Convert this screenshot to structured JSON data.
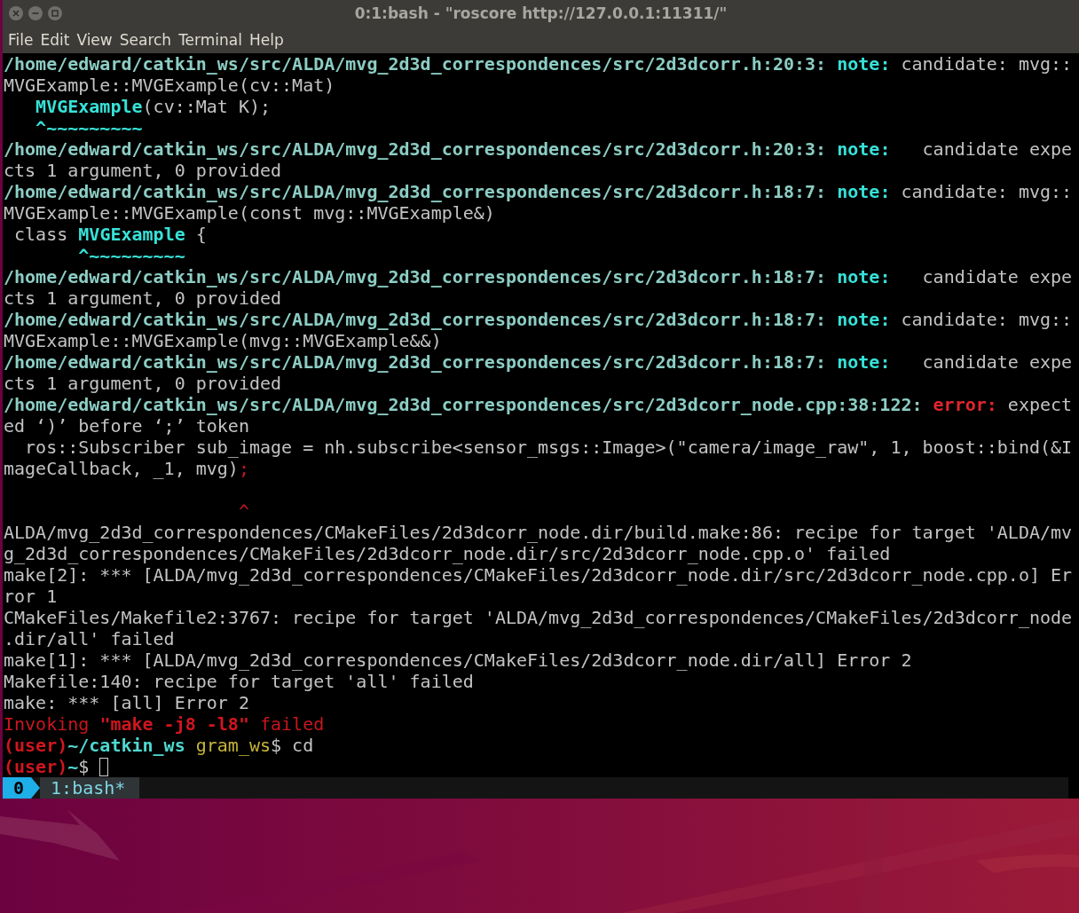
{
  "window": {
    "title": "0:1:bash - \"roscore http://127.0.0.1:11311/\""
  },
  "menu": [
    "File",
    "Edit",
    "View",
    "Search",
    "Terminal",
    "Help"
  ],
  "terminal": {
    "lines": [
      {
        "cursor": false,
        "segments": [
          {
            "kind": "path",
            "text": "/home/edward/catkin_ws/src/ALDA/mvg_2d3d_correspondences/src/2d3dcorr.h:20:3:"
          },
          {
            "kind": "note",
            "text": " note:"
          },
          {
            "kind": "plain",
            "text": " candidate: mvg::"
          }
        ]
      },
      {
        "cursor": false,
        "segments": [
          {
            "kind": "plain",
            "text": "MVGExample::MVGExample(cv::Mat)"
          }
        ]
      },
      {
        "cursor": false,
        "segments": [
          {
            "kind": "name",
            "text": "   MVGExample"
          },
          {
            "kind": "plain",
            "text": "(cv::Mat K);"
          }
        ]
      },
      {
        "cursor": false,
        "segments": [
          {
            "kind": "name",
            "text": "   ^~~~~~~~~~"
          }
        ]
      },
      {
        "cursor": false,
        "segments": [
          {
            "kind": "path",
            "text": "/home/edward/catkin_ws/src/ALDA/mvg_2d3d_correspondences/src/2d3dcorr.h:20:3:"
          },
          {
            "kind": "note",
            "text": " note:"
          },
          {
            "kind": "plain",
            "text": "   candidate expe"
          }
        ]
      },
      {
        "cursor": false,
        "segments": [
          {
            "kind": "plain",
            "text": "cts 1 argument, 0 provided"
          }
        ]
      },
      {
        "cursor": false,
        "segments": [
          {
            "kind": "path",
            "text": "/home/edward/catkin_ws/src/ALDA/mvg_2d3d_correspondences/src/2d3dcorr.h:18:7:"
          },
          {
            "kind": "note",
            "text": " note:"
          },
          {
            "kind": "plain",
            "text": " candidate: mvg::"
          }
        ]
      },
      {
        "cursor": false,
        "segments": [
          {
            "kind": "plain",
            "text": "MVGExample::MVGExample(const mvg::MVGExample&)"
          }
        ]
      },
      {
        "cursor": false,
        "segments": [
          {
            "kind": "plain",
            "text": " class "
          },
          {
            "kind": "name",
            "text": "MVGExample"
          },
          {
            "kind": "plain",
            "text": " {"
          }
        ]
      },
      {
        "cursor": false,
        "segments": [
          {
            "kind": "name",
            "text": "       ^~~~~~~~~~"
          }
        ]
      },
      {
        "cursor": false,
        "segments": [
          {
            "kind": "path",
            "text": "/home/edward/catkin_ws/src/ALDA/mvg_2d3d_correspondences/src/2d3dcorr.h:18:7:"
          },
          {
            "kind": "note",
            "text": " note:"
          },
          {
            "kind": "plain",
            "text": "   candidate expe"
          }
        ]
      },
      {
        "cursor": false,
        "segments": [
          {
            "kind": "plain",
            "text": "cts 1 argument, 0 provided"
          }
        ]
      },
      {
        "cursor": false,
        "segments": [
          {
            "kind": "path",
            "text": "/home/edward/catkin_ws/src/ALDA/mvg_2d3d_correspondences/src/2d3dcorr.h:18:7:"
          },
          {
            "kind": "note",
            "text": " note:"
          },
          {
            "kind": "plain",
            "text": " candidate: mvg::"
          }
        ]
      },
      {
        "cursor": false,
        "segments": [
          {
            "kind": "plain",
            "text": "MVGExample::MVGExample(mvg::MVGExample&&)"
          }
        ]
      },
      {
        "cursor": false,
        "segments": [
          {
            "kind": "path",
            "text": "/home/edward/catkin_ws/src/ALDA/mvg_2d3d_correspondences/src/2d3dcorr.h:18:7:"
          },
          {
            "kind": "note",
            "text": " note:"
          },
          {
            "kind": "plain",
            "text": "   candidate expe"
          }
        ]
      },
      {
        "cursor": false,
        "segments": [
          {
            "kind": "plain",
            "text": "cts 1 argument, 0 provided"
          }
        ]
      },
      {
        "cursor": false,
        "segments": [
          {
            "kind": "path",
            "text": "/home/edward/catkin_ws/src/ALDA/mvg_2d3d_correspondences/src/2d3dcorr_node.cpp:38:122:"
          },
          {
            "kind": "error",
            "text": " error:"
          },
          {
            "kind": "plain",
            "text": " expect"
          }
        ]
      },
      {
        "cursor": false,
        "segments": [
          {
            "kind": "plain",
            "text": "ed ‘)’ before ‘;’ token"
          }
        ]
      },
      {
        "cursor": false,
        "segments": [
          {
            "kind": "plain",
            "text": "  ros::Subscriber sub_image = nh.subscribe<sensor_msgs::Image>(\"camera/image_raw\", 1, boost::bind(&I"
          }
        ]
      },
      {
        "cursor": false,
        "segments": [
          {
            "kind": "plain",
            "text": "mageCallback, _1, mvg)"
          },
          {
            "kind": "red",
            "text": ";"
          }
        ]
      },
      {
        "cursor": false
      },
      {
        "cursor": false,
        "segments": [
          {
            "kind": "red",
            "text": "                      ^"
          }
        ]
      },
      {
        "cursor": false,
        "segments": [
          {
            "kind": "plain",
            "text": "ALDA/mvg_2d3d_correspondences/CMakeFiles/2d3dcorr_node.dir/build.make:86: recipe for target 'ALDA/mv"
          }
        ]
      },
      {
        "cursor": false,
        "segments": [
          {
            "kind": "plain",
            "text": "g_2d3d_correspondences/CMakeFiles/2d3dcorr_node.dir/src/2d3dcorr_node.cpp.o' failed"
          }
        ]
      },
      {
        "cursor": false,
        "segments": [
          {
            "kind": "plain",
            "text": "make[2]: *** [ALDA/mvg_2d3d_correspondences/CMakeFiles/2d3dcorr_node.dir/src/2d3dcorr_node.cpp.o] Er"
          }
        ]
      },
      {
        "cursor": false,
        "segments": [
          {
            "kind": "plain",
            "text": "ror 1"
          }
        ]
      },
      {
        "cursor": false,
        "segments": [
          {
            "kind": "plain",
            "text": "CMakeFiles/Makefile2:3767: recipe for target 'ALDA/mvg_2d3d_correspondences/CMakeFiles/2d3dcorr_node"
          }
        ]
      },
      {
        "cursor": false,
        "segments": [
          {
            "kind": "plain",
            "text": ".dir/all' failed"
          }
        ]
      },
      {
        "cursor": false,
        "segments": [
          {
            "kind": "plain",
            "text": "make[1]: *** [ALDA/mvg_2d3d_correspondences/CMakeFiles/2d3dcorr_node.dir/all] Error 2"
          }
        ]
      },
      {
        "cursor": false,
        "segments": [
          {
            "kind": "plain",
            "text": "Makefile:140: recipe for target 'all' failed"
          }
        ]
      },
      {
        "cursor": false,
        "segments": [
          {
            "kind": "plain",
            "text": "make: *** [all] Error 2"
          }
        ]
      },
      {
        "cursor": false,
        "segments": [
          {
            "kind": "red",
            "text": "Invoking "
          },
          {
            "kind": "red-bold",
            "text": "\"make -j8 -l8\""
          },
          {
            "kind": "red",
            "text": " failed"
          }
        ]
      },
      {
        "cursor": false,
        "segments": [
          {
            "kind": "red-bold",
            "text": "(user)"
          },
          {
            "kind": "dir",
            "text": "~/catkin_ws"
          },
          {
            "kind": "branch",
            "text": " gram_ws"
          },
          {
            "kind": "plain",
            "text": "$ cd"
          }
        ]
      },
      {
        "cursor": true,
        "segments": [
          {
            "kind": "red-bold",
            "text": "(user)"
          },
          {
            "kind": "dir",
            "text": "~"
          },
          {
            "kind": "plain",
            "text": "$ "
          }
        ]
      }
    ]
  },
  "status_bar": {
    "session": "0",
    "windows": [
      {
        "label": "1:bash*",
        "selected": true
      }
    ]
  }
}
